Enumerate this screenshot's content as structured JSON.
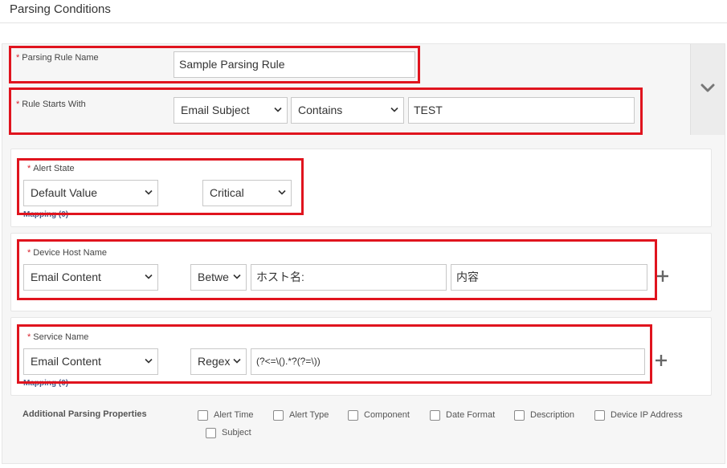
{
  "page": {
    "title": "Parsing Conditions"
  },
  "rule_name": {
    "label": "Parsing Rule Name",
    "value": "Sample Parsing Rule"
  },
  "rule_starts_with": {
    "label": "Rule Starts With",
    "source": "Email Subject",
    "operator": "Contains",
    "value": "TEST"
  },
  "alert_state": {
    "label": "Alert State",
    "source": "Default Value",
    "value": "Critical",
    "mapping_link": "Mapping (0)"
  },
  "device_host_name": {
    "label": "Device Host Name",
    "source": "Email Content",
    "operator": "Betwe",
    "start_value": "ホスト名:",
    "end_value": "内容"
  },
  "service_name": {
    "label": "Service Name",
    "source": "Email Content",
    "operator": "Regex",
    "value": "(?<=\\().*?(?=\\))",
    "mapping_link": "Mapping (0)"
  },
  "additional": {
    "label": "Additional Parsing Properties",
    "options": [
      "Alert Time",
      "Alert Type",
      "Component",
      "Date Format",
      "Description",
      "Device IP Address",
      "Subject"
    ]
  },
  "colors": {
    "required": "#d9232d",
    "highlight": "#e0141e",
    "link": "#4a5c88"
  },
  "icons": {
    "collapse": "chevron-down-icon",
    "add": "plus-icon",
    "dropdown": "caret-down-icon"
  }
}
